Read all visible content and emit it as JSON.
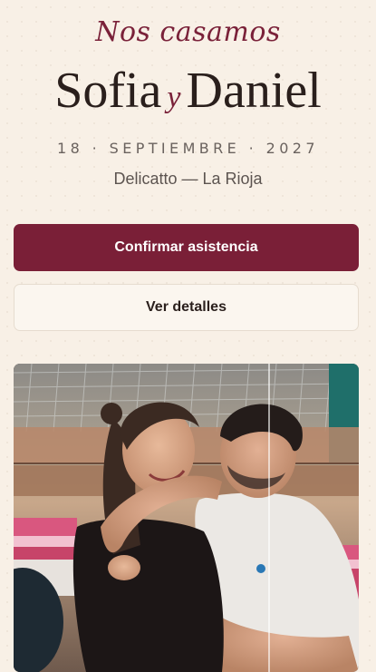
{
  "hero": {
    "kicker": "Nos casamos",
    "name_one": "Sofia",
    "conjunction": "y",
    "name_two": "Daniel",
    "date": "18 · SEPTIEMBRE · 2027",
    "venue": "Delicatto — La Rioja"
  },
  "actions": {
    "confirm_label": "Confirmar asistencia",
    "details_label": "Ver detalles"
  },
  "colors": {
    "background": "#f8f0e6",
    "accent": "#7a1f37",
    "text": "#2a1f1c"
  }
}
